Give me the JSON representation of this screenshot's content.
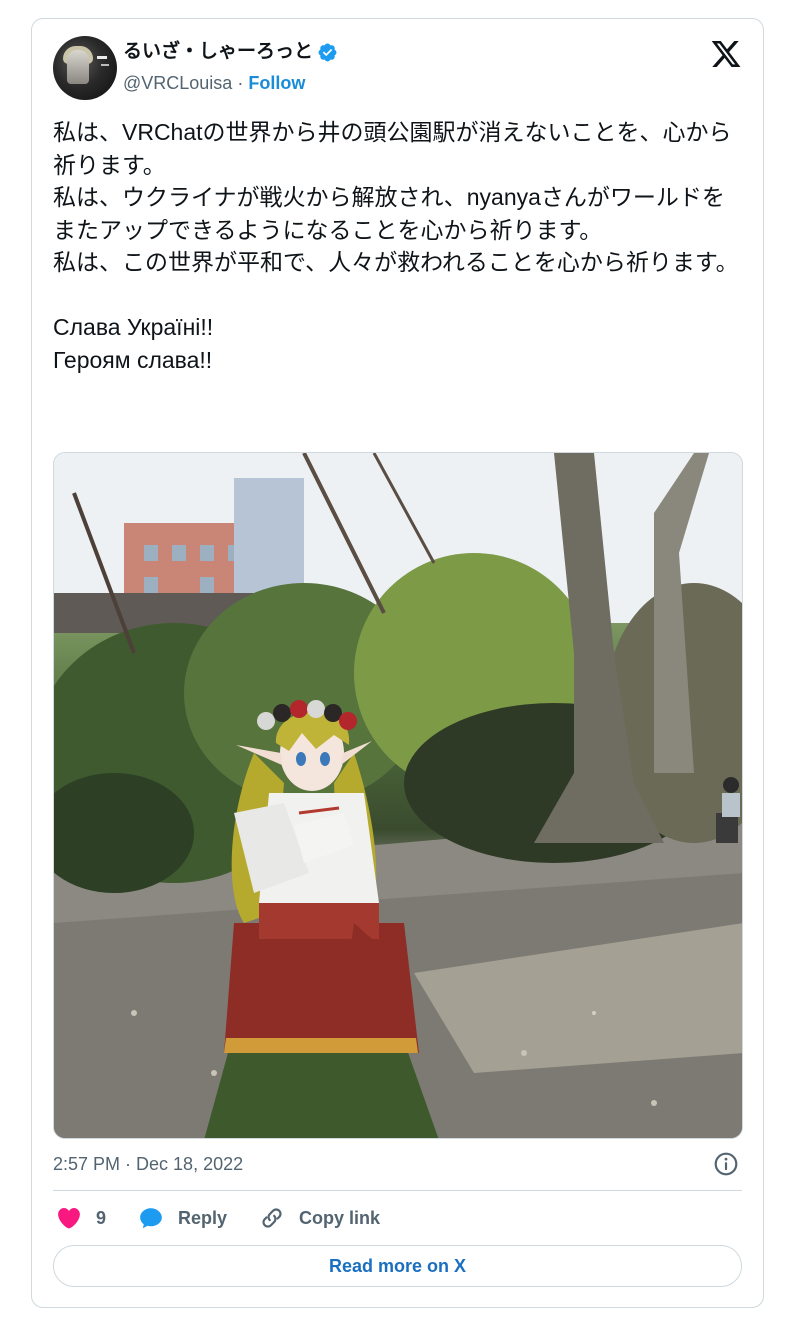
{
  "author": {
    "display_name": "るいざ・しゃーろっと",
    "handle": "@VRCLouisa",
    "separator": "·",
    "follow_label": "Follow"
  },
  "tweet": {
    "text": "私は、VRChatの世界から井の頭公園駅が消えないことを、心から祈ります。\n私は、ウクライナが戦火から解放され、nyanyaさんがワールドをまたアップできるようになることを心から祈ります。\n私は、この世界が平和で、人々が救われることを心から祈ります。\n\nСлава Україні!!\nГероям слава!!",
    "timestamp": "2:57 PM · Dec 18, 2022"
  },
  "actions": {
    "like_count": "9",
    "reply_label": "Reply",
    "copy_link_label": "Copy link"
  },
  "footer": {
    "read_more_label": "Read more on X"
  },
  "icons": {
    "verified": "verified-badge-icon",
    "x_logo": "x-logo-icon",
    "info": "info-icon",
    "like": "heart-icon",
    "reply": "reply-bubble-icon",
    "copy_link": "link-icon"
  },
  "colors": {
    "like": "#f91880",
    "reply": "#1d9bf0",
    "link_text": "#1a6fc0",
    "verified": "#1d9bf0",
    "muted": "#536471"
  }
}
